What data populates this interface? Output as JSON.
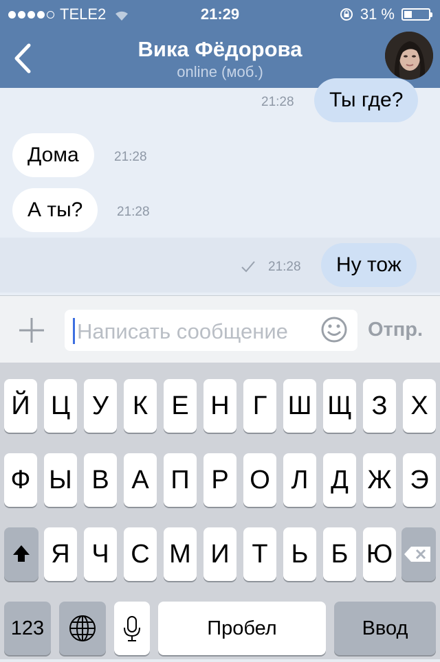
{
  "status_bar": {
    "carrier": "TELE2",
    "time": "21:29",
    "battery_text": "31 %",
    "battery_level": 0.31,
    "signal_bars_filled": 4,
    "signal_bars_total": 5
  },
  "header": {
    "back_icon": "chevron-left-icon",
    "contact_name": "Вика Фёдорова",
    "status": "online (моб.)",
    "avatar_icon": "avatar-photo"
  },
  "messages": [
    {
      "direction": "out",
      "text": "Ты где?",
      "time": "21:28"
    },
    {
      "direction": "in",
      "text": "Дома",
      "time": "21:28"
    },
    {
      "direction": "in",
      "text": "А ты?",
      "time": "21:28"
    },
    {
      "direction": "out",
      "text": "Ну тож",
      "time": "21:28",
      "read_icon": "checkmark-icon"
    }
  ],
  "composer": {
    "attach_icon": "plus-icon",
    "placeholder": "Написать сообщение",
    "emoji_icon": "smiley-icon",
    "send_label": "Отпр."
  },
  "keyboard": {
    "row1": [
      "Й",
      "Ц",
      "У",
      "К",
      "Е",
      "Н",
      "Г",
      "Ш",
      "Щ",
      "З",
      "Х"
    ],
    "row2": [
      "Ф",
      "Ы",
      "В",
      "А",
      "П",
      "Р",
      "О",
      "Л",
      "Д",
      "Ж",
      "Э"
    ],
    "row3": [
      "Я",
      "Ч",
      "С",
      "М",
      "И",
      "Т",
      "Ь",
      "Б",
      "Ю"
    ],
    "shift_icon": "shift-arrow-icon",
    "delete_icon": "backspace-icon",
    "numbers_label": "123",
    "globe_icon": "globe-icon",
    "mic_icon": "microphone-icon",
    "space_label": "Пробел",
    "return_label": "Ввод"
  },
  "colors": {
    "header_bg": "#5a7fad",
    "incoming_bubble": "#ffffff",
    "outgoing_bubble": "#cfe0f5",
    "chat_bg": "#e8eef6",
    "caret": "#3d6fe0"
  }
}
